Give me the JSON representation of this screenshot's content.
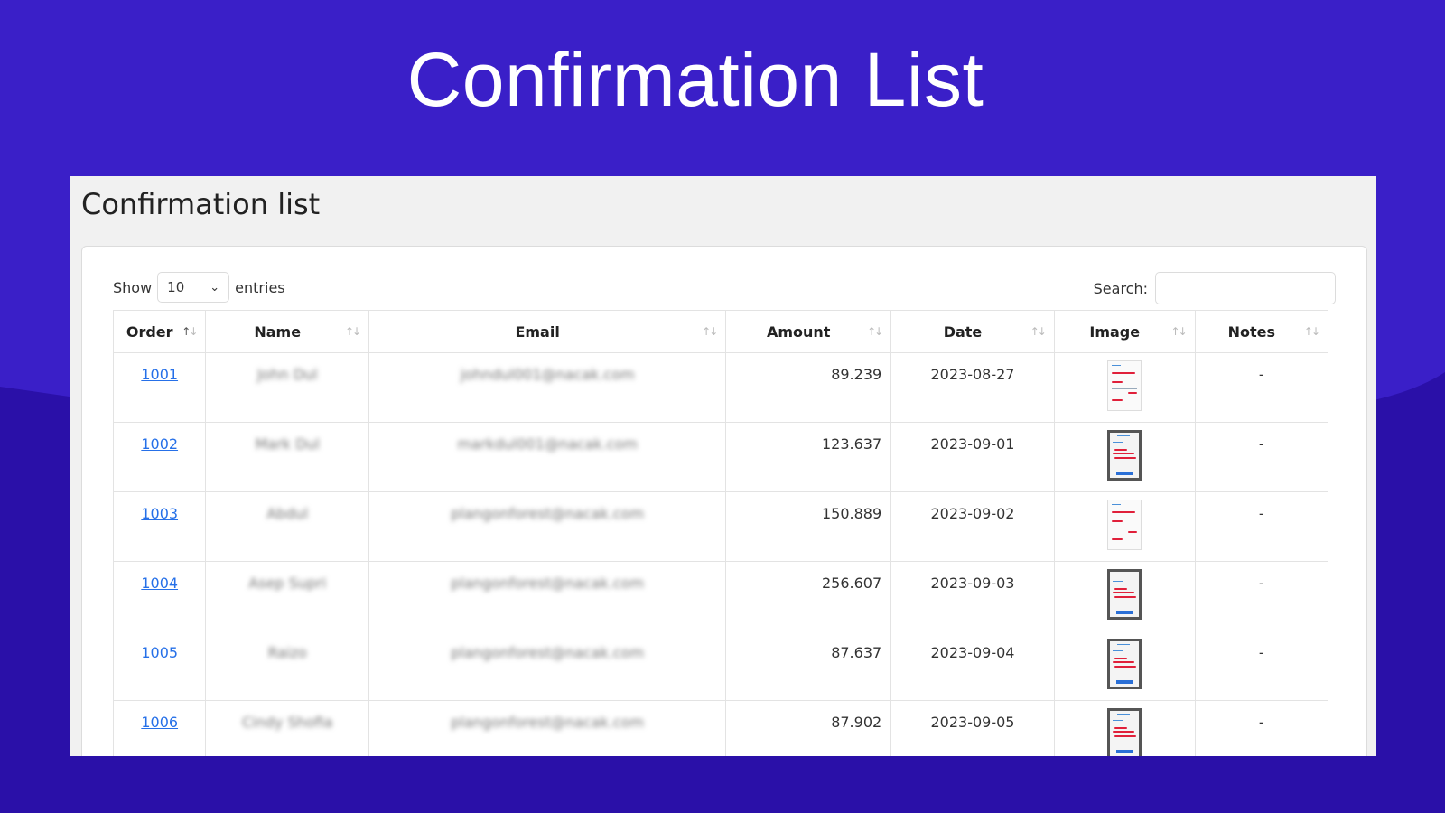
{
  "slide": {
    "title": "Confirmation List"
  },
  "colors": {
    "background_top": "#3a1fc8",
    "background_bottom": "#2a10a8",
    "link": "#2670e8"
  },
  "panel": {
    "title": "Confirmation list"
  },
  "controls": {
    "show_label": "Show",
    "entries_value": "10",
    "entries_label": "entries",
    "search_label": "Search:",
    "search_value": ""
  },
  "table": {
    "columns": [
      {
        "label": "Order",
        "sort": "asc"
      },
      {
        "label": "Name",
        "sort": "none"
      },
      {
        "label": "Email",
        "sort": "none"
      },
      {
        "label": "Amount",
        "sort": "none"
      },
      {
        "label": "Date",
        "sort": "none"
      },
      {
        "label": "Image",
        "sort": "none"
      },
      {
        "label": "Notes",
        "sort": "none"
      }
    ],
    "rows": [
      {
        "order": "1001",
        "name": "John Dul",
        "email": "johndul001@nacak.com",
        "amount": "89.239",
        "date": "2023-08-27",
        "image": "receipt",
        "notes": "-"
      },
      {
        "order": "1002",
        "name": "Mark Dul",
        "email": "markdul001@nacak.com",
        "amount": "123.637",
        "date": "2023-09-01",
        "image": "phone",
        "notes": "-"
      },
      {
        "order": "1003",
        "name": "Abdul",
        "email": "plangonforest@nacak.com",
        "amount": "150.889",
        "date": "2023-09-02",
        "image": "receipt",
        "notes": "-"
      },
      {
        "order": "1004",
        "name": "Asep Supri",
        "email": "plangonforest@nacak.com",
        "amount": "256.607",
        "date": "2023-09-03",
        "image": "phone",
        "notes": "-"
      },
      {
        "order": "1005",
        "name": "Raizo",
        "email": "plangonforest@nacak.com",
        "amount": "87.637",
        "date": "2023-09-04",
        "image": "phone",
        "notes": "-"
      },
      {
        "order": "1006",
        "name": "Cindy Shofia",
        "email": "plangonforest@nacak.com",
        "amount": "87.902",
        "date": "2023-09-05",
        "image": "phone",
        "notes": "-"
      }
    ]
  }
}
